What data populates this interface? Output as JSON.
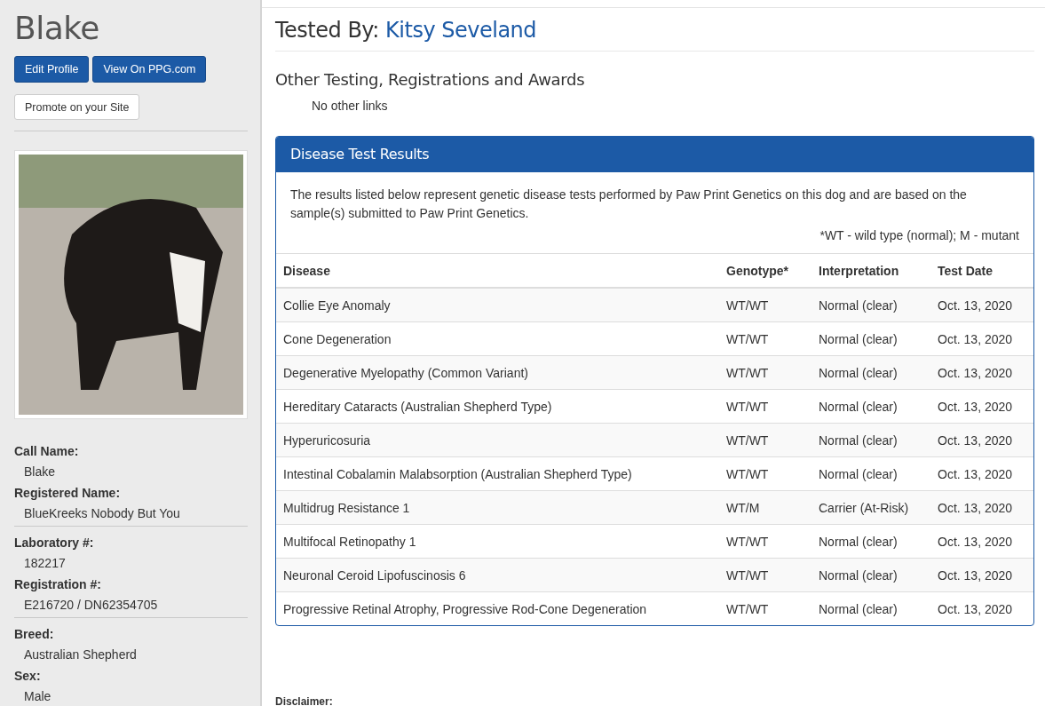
{
  "profile": {
    "name": "Blake",
    "buttons": [
      {
        "label": "Edit Profile",
        "kind": "primary"
      },
      {
        "label": "View On PPG.com",
        "kind": "primary"
      },
      {
        "label": "Promote on your Site",
        "kind": "default"
      }
    ],
    "field_groups": [
      [
        {
          "label": "Call Name:",
          "value": "Blake"
        },
        {
          "label": "Registered Name:",
          "value": "BlueKreeks Nobody But You"
        }
      ],
      [
        {
          "label": "Laboratory #:",
          "value": "182217"
        },
        {
          "label": "Registration #:",
          "value": "E216720 / DN62354705"
        }
      ],
      [
        {
          "label": "Breed:",
          "value": "Australian Shepherd"
        },
        {
          "label": "Sex:",
          "value": "Male"
        }
      ]
    ]
  },
  "tested_by": {
    "label": "Tested By:",
    "name": "Kitsy Seveland"
  },
  "other_links": {
    "heading": "Other Testing, Registrations and Awards",
    "text": "No other links"
  },
  "results": {
    "title": "Disease Test Results",
    "intro": "The results listed below represent genetic disease tests performed by Paw Print Genetics on this dog and are based on the sample(s) submitted to Paw Print Genetics.",
    "legend": "*WT - wild type (normal); M - mutant",
    "columns": [
      "Disease",
      "Genotype*",
      "Interpretation",
      "Test Date"
    ],
    "rows": [
      [
        "Collie Eye Anomaly",
        "WT/WT",
        "Normal (clear)",
        "Oct. 13, 2020"
      ],
      [
        "Cone Degeneration",
        "WT/WT",
        "Normal (clear)",
        "Oct. 13, 2020"
      ],
      [
        "Degenerative Myelopathy (Common Variant)",
        "WT/WT",
        "Normal (clear)",
        "Oct. 13, 2020"
      ],
      [
        "Hereditary Cataracts (Australian Shepherd Type)",
        "WT/WT",
        "Normal (clear)",
        "Oct. 13, 2020"
      ],
      [
        "Hyperuricosuria",
        "WT/WT",
        "Normal (clear)",
        "Oct. 13, 2020"
      ],
      [
        "Intestinal Cobalamin Malabsorption (Australian Shepherd Type)",
        "WT/WT",
        "Normal (clear)",
        "Oct. 13, 2020"
      ],
      [
        "Multidrug Resistance 1",
        "WT/M",
        "Carrier (At-Risk)",
        "Oct. 13, 2020"
      ],
      [
        "Multifocal Retinopathy 1",
        "WT/WT",
        "Normal (clear)",
        "Oct. 13, 2020"
      ],
      [
        "Neuronal Ceroid Lipofuscinosis 6",
        "WT/WT",
        "Normal (clear)",
        "Oct. 13, 2020"
      ],
      [
        "Progressive Retinal Atrophy, Progressive Rod-Cone Degeneration",
        "WT/WT",
        "Normal (clear)",
        "Oct. 13, 2020"
      ]
    ]
  },
  "disclaimer": {
    "label": "Disclaimer:"
  }
}
